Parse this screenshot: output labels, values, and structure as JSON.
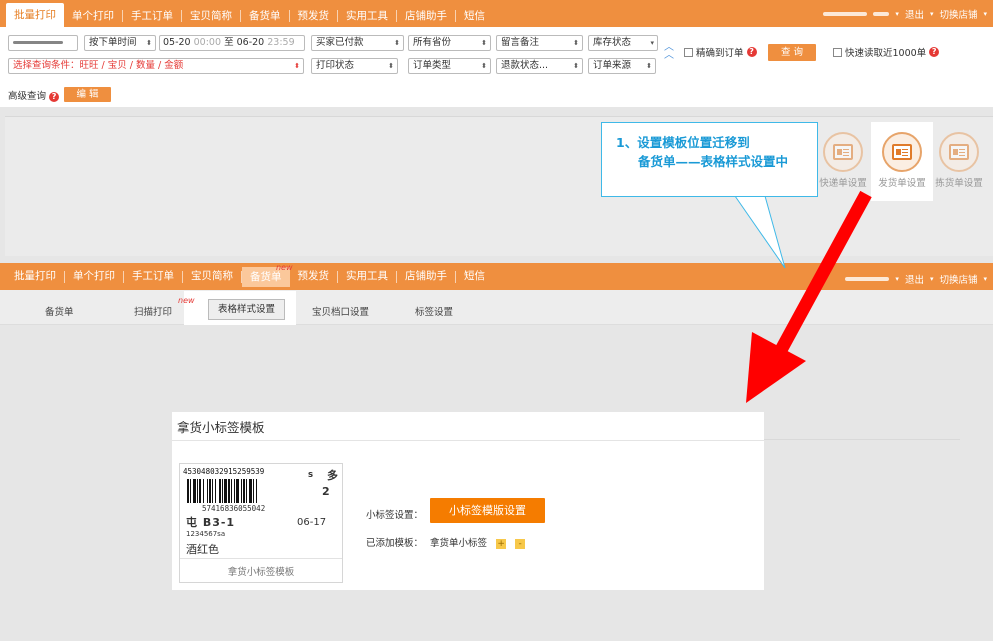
{
  "top_nav": {
    "items": [
      "批量打印",
      "单个打印",
      "手工订单",
      "宝贝简称",
      "备货单",
      "预发货",
      "实用工具",
      "店铺助手",
      "短信"
    ],
    "right": {
      "exit": "退出",
      "switch_store": "切换店铺"
    }
  },
  "filter": {
    "order_time": "按下单时间",
    "date_from": "05-20",
    "time_from": "00:00",
    "to": "至",
    "date_to": "06-20",
    "time_to": "23:59",
    "buyer_paid": "买家已付款",
    "all_provinces": "所有省份",
    "note": "留言备注",
    "stock_status": "库存状态",
    "precise_order": "精确到订单",
    "query_btn": "查 询",
    "quick_read": "快速读取近1000单",
    "query_condition": "选择查询条件：旺旺 / 宝贝 / 数量 / 金额",
    "print_status": "打印状态",
    "order_type": "订单类型",
    "refund_status": "退款状态...",
    "order_source": "订单来源",
    "advanced": "高级查询",
    "edit_btn": "编 辑"
  },
  "settings_icons": [
    {
      "label": "快递单设置",
      "icon": "express-doc-icon"
    },
    {
      "label": "发货单设置",
      "icon": "ship-doc-icon"
    },
    {
      "label": "拣货单设置",
      "icon": "pick-doc-icon"
    }
  ],
  "callout": {
    "line1": "1、设置模板位置迁移到",
    "line2": "备货单——表格样式设置中"
  },
  "second_nav": {
    "items": [
      "批量打印",
      "单个打印",
      "手工订单",
      "宝贝简称",
      "备货单",
      "预发货",
      "实用工具",
      "店铺助手",
      "短信"
    ],
    "new_badge": "new",
    "right": {
      "exit": "退出",
      "switch_store": "切换店铺"
    }
  },
  "sub_tabs": {
    "items": [
      "备货单",
      "扫描打印",
      "表格样式设置",
      "宝贝档口设置",
      "标签设置"
    ],
    "new_badge": "new"
  },
  "template_panel": {
    "title": "拿货小标签模板",
    "label_card": {
      "order_no": "453048032915259539",
      "size": "s",
      "multi": "多",
      "qty": "2",
      "barcode_text": "57416836055042",
      "location": "屯  B3-1",
      "date": "06-17",
      "small_code": "1234567sa",
      "color": "酒红色",
      "name": "拿货小标签模板"
    },
    "setting_label": "小标签设置：",
    "setting_btn": "小标签模版设置",
    "added_label": "已添加模板：",
    "added_name": "拿货单小标签",
    "plus": "+",
    "minus": "-"
  },
  "colors": {
    "nav_orange": "#ef8f3f",
    "button_orange": "#f57c00",
    "callout_blue": "#1a9ad6",
    "arrow_red": "#ff0000"
  }
}
